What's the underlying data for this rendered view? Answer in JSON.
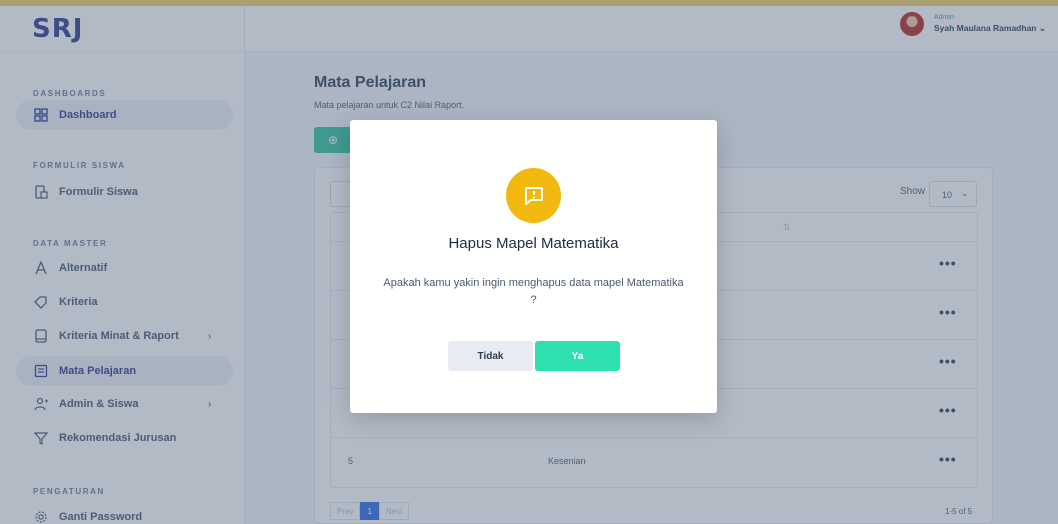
{
  "app": {
    "logo": "SRJ"
  },
  "header": {
    "user_role": "Admin",
    "user_name": "Syah Maulana Ramadhan"
  },
  "sidebar": {
    "sections": [
      "DASHBOARDS",
      "FORMULIR SISWA",
      "DATA MASTER",
      "PENGATURAN"
    ],
    "items": [
      {
        "label": "Dashboard",
        "icon": "dashboard-grid-icon"
      },
      {
        "label": "Formulir Siswa",
        "icon": "form-icon"
      },
      {
        "label": "Alternatif",
        "icon": "letter-a-icon"
      },
      {
        "label": "Kriteria",
        "icon": "tag-icon"
      },
      {
        "label": "Kriteria Minat & Raport",
        "icon": "tablet-icon"
      },
      {
        "label": "Mata Pelajaran",
        "icon": "list-icon"
      },
      {
        "label": "Admin & Siswa",
        "icon": "user-add-icon"
      },
      {
        "label": "Rekomendasi Jurusan",
        "icon": "filter-icon"
      },
      {
        "label": "Ganti Password",
        "icon": "gear-icon"
      }
    ]
  },
  "main": {
    "title": "Mata Pelajaran",
    "subtitle": "Mata pelajaran untuk C2 Nilai Raport.",
    "show_label": "Show",
    "show_value": "10",
    "table": {
      "rows": [
        {
          "no": "5",
          "mapel": "Kesenian"
        }
      ]
    },
    "pagination": {
      "prev": "Prev",
      "page": "1",
      "next": "Next",
      "range": "1-5 of 5"
    }
  },
  "modal": {
    "title": "Hapus Mapel Matematika",
    "message": "Apakah kamu yakin ingin menghapus data mapel Matematika ?",
    "cancel_label": "Tidak",
    "confirm_label": "Ya"
  },
  "colors": {
    "accent": "#2ec79b",
    "modal_icon": "#f1b80d",
    "confirm": "#2ee0b0",
    "page_active": "#2a6be0"
  }
}
